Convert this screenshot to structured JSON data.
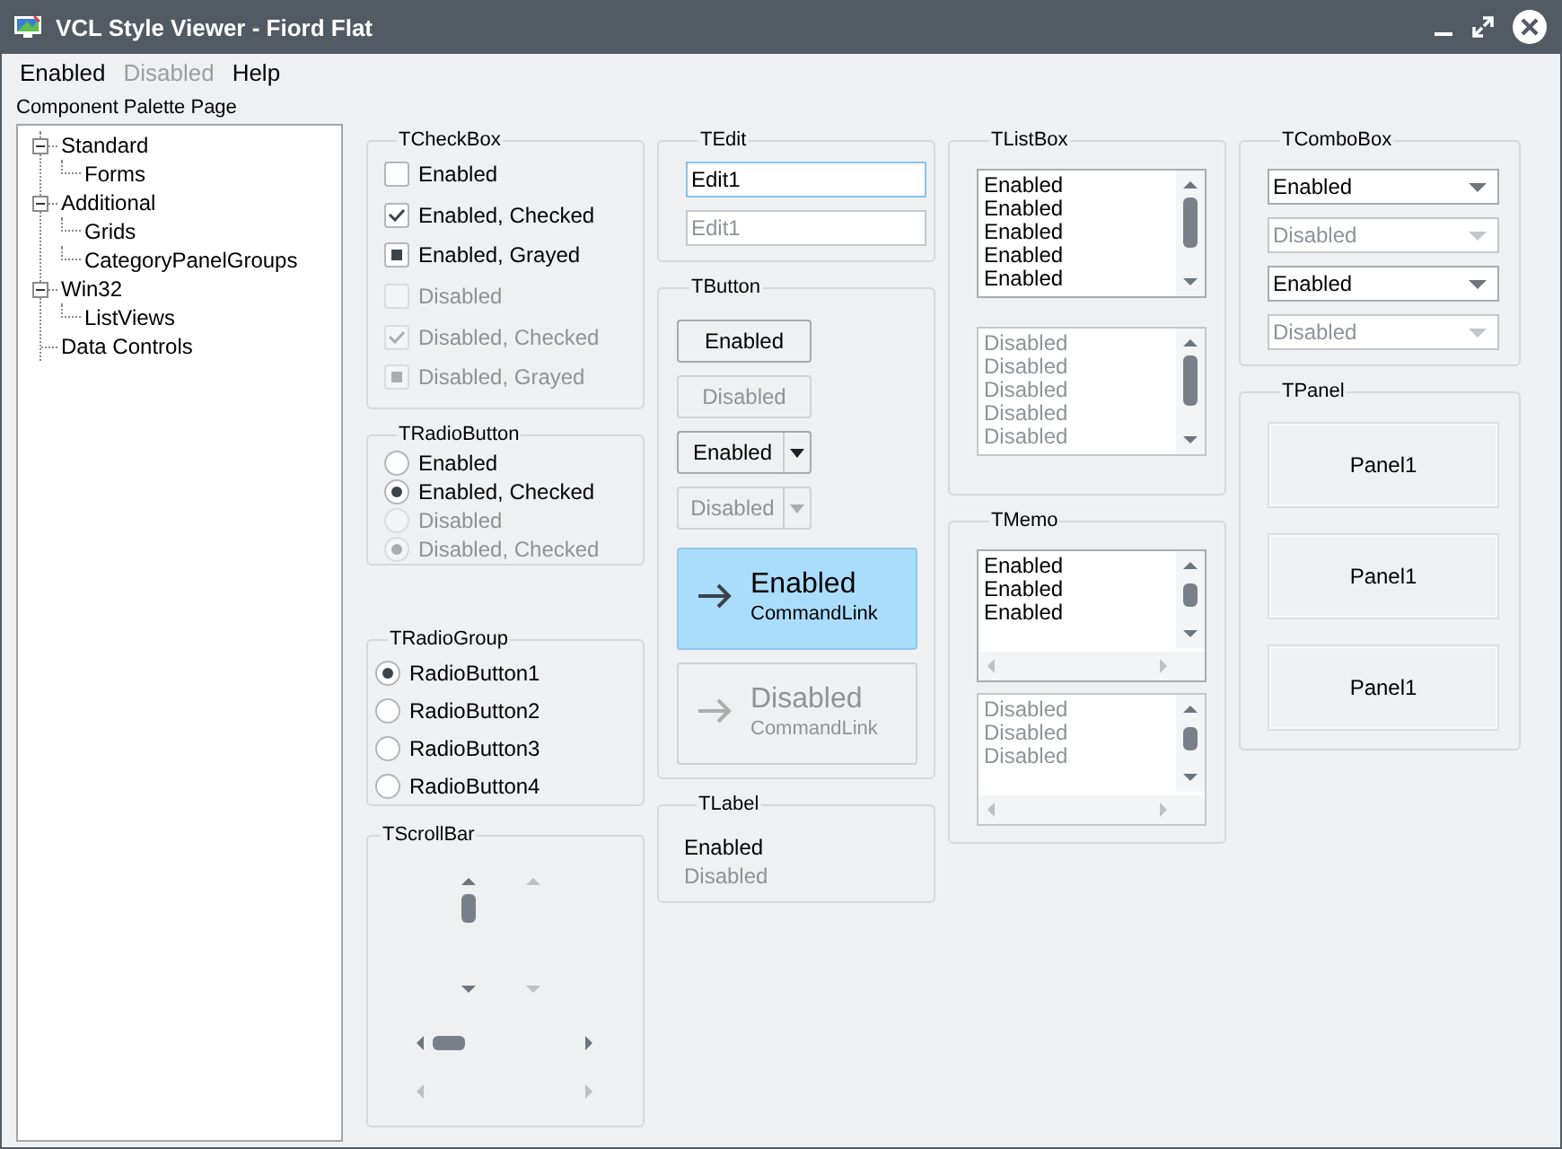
{
  "window": {
    "title": "VCL Style Viewer - Fiord Flat"
  },
  "menu": [
    {
      "label": "Enabled",
      "disabled": false
    },
    {
      "label": "Disabled",
      "disabled": true
    },
    {
      "label": "Help",
      "disabled": false
    }
  ],
  "palette": {
    "label": "Component Palette Page",
    "tree": [
      {
        "label": "Standard",
        "expanded": true,
        "children": [
          {
            "label": "Forms"
          }
        ]
      },
      {
        "label": "Additional",
        "expanded": true,
        "children": [
          {
            "label": "Grids"
          },
          {
            "label": "CategoryPanelGroups"
          }
        ]
      },
      {
        "label": "Win32",
        "expanded": true,
        "children": [
          {
            "label": "ListViews"
          }
        ]
      },
      {
        "label": "Data Controls"
      }
    ]
  },
  "checkboxes": {
    "title": "TCheckBox",
    "items": [
      {
        "label": "Enabled",
        "checked": false,
        "grayed": false,
        "disabled": false
      },
      {
        "label": "Enabled, Checked",
        "checked": true,
        "grayed": false,
        "disabled": false
      },
      {
        "label": "Enabled, Grayed",
        "checked": false,
        "grayed": true,
        "disabled": false
      },
      {
        "label": "Disabled",
        "checked": false,
        "grayed": false,
        "disabled": true
      },
      {
        "label": "Disabled, Checked",
        "checked": true,
        "grayed": false,
        "disabled": true
      },
      {
        "label": "Disabled, Grayed",
        "checked": false,
        "grayed": true,
        "disabled": true
      }
    ]
  },
  "radio_buttons": {
    "title": "TRadioButton",
    "items": [
      {
        "label": "Enabled",
        "checked": false,
        "disabled": false
      },
      {
        "label": "Enabled, Checked",
        "checked": true,
        "disabled": false
      },
      {
        "label": "Disabled",
        "checked": false,
        "disabled": true
      },
      {
        "label": "Disabled, Checked",
        "checked": true,
        "disabled": true
      }
    ]
  },
  "radio_group": {
    "title": "TRadioGroup",
    "items": [
      {
        "label": "RadioButton1",
        "selected": true
      },
      {
        "label": "RadioButton2",
        "selected": false
      },
      {
        "label": "RadioButton3",
        "selected": false
      },
      {
        "label": "RadioButton4",
        "selected": false
      }
    ]
  },
  "scrollbars": {
    "title": "TScrollBar",
    "items": [
      {
        "vertical": true,
        "disabled": false
      },
      {
        "vertical": true,
        "disabled": true
      },
      {
        "vertical": false,
        "disabled": false
      },
      {
        "vertical": false,
        "disabled": true
      }
    ]
  },
  "edits": {
    "title": "TEdit",
    "items": [
      {
        "value": "Edit1",
        "focused": true,
        "disabled": false
      },
      {
        "value": "Edit1",
        "focused": false,
        "disabled": true
      }
    ]
  },
  "buttons": {
    "title": "TButton",
    "items": [
      {
        "kind": "push",
        "label": "Enabled",
        "disabled": false
      },
      {
        "kind": "push",
        "label": "Disabled",
        "disabled": true
      },
      {
        "kind": "split",
        "label": "Enabled",
        "disabled": false
      },
      {
        "kind": "split",
        "label": "Disabled",
        "disabled": true
      },
      {
        "kind": "command_link",
        "label": "Enabled",
        "note": "CommandLink",
        "hot": true,
        "disabled": false
      },
      {
        "kind": "command_link",
        "label": "Disabled",
        "note": "CommandLink",
        "hot": false,
        "disabled": true
      }
    ]
  },
  "labels": {
    "title": "TLabel",
    "items": [
      {
        "text": "Enabled",
        "disabled": false
      },
      {
        "text": "Disabled",
        "disabled": true
      }
    ]
  },
  "list_boxes": {
    "title": "TListBox",
    "items": [
      {
        "disabled": false,
        "lines": [
          "Enabled",
          "Enabled",
          "Enabled",
          "Enabled",
          "Enabled"
        ]
      },
      {
        "disabled": true,
        "lines": [
          "Disabled",
          "Disabled",
          "Disabled",
          "Disabled",
          "Disabled"
        ]
      }
    ]
  },
  "memos": {
    "title": "TMemo",
    "items": [
      {
        "disabled": false,
        "lines": [
          "Enabled",
          "Enabled",
          "Enabled"
        ]
      },
      {
        "disabled": true,
        "lines": [
          "Disabled",
          "Disabled",
          "Disabled"
        ]
      }
    ]
  },
  "combo_boxes": {
    "title": "TComboBox",
    "items": [
      {
        "value": "Enabled",
        "disabled": false
      },
      {
        "value": "Disabled",
        "disabled": true
      },
      {
        "value": "Enabled",
        "disabled": false
      },
      {
        "value": "Disabled",
        "disabled": true
      }
    ]
  },
  "panels": {
    "title": "TPanel",
    "items": [
      {
        "caption": "Panel1"
      },
      {
        "caption": "Panel1"
      },
      {
        "caption": "Panel1"
      }
    ]
  }
}
